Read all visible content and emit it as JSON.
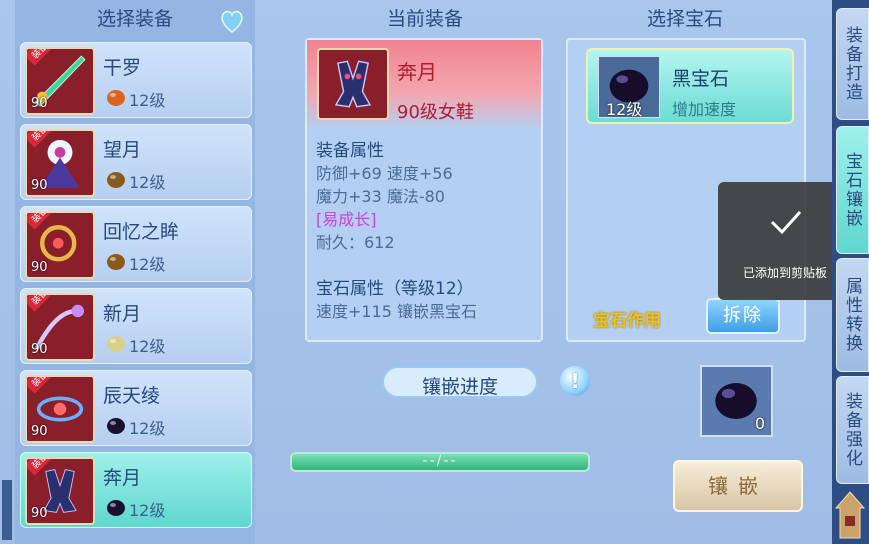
{
  "headers": {
    "left": "选择装备",
    "middle": "当前装备",
    "right": "选择宝石"
  },
  "equipment_list": [
    {
      "name": "干罗",
      "level": "90",
      "tag": "装备中",
      "gem_level": "12级",
      "gem_color": "#d9651f"
    },
    {
      "name": "望月",
      "level": "90",
      "tag": "装备中",
      "gem_level": "12级",
      "gem_color": "#8a5a1c"
    },
    {
      "name": "回忆之眸",
      "level": "90",
      "tag": "装备中",
      "gem_level": "12级",
      "gem_color": "#8a5a1c"
    },
    {
      "name": "新月",
      "level": "90",
      "tag": "装备中",
      "gem_level": "12级",
      "gem_color": "#d8d08a"
    },
    {
      "name": "辰天绫",
      "level": "90",
      "tag": "装备中",
      "gem_level": "12级",
      "gem_color": "#1a1030"
    },
    {
      "name": "奔月",
      "level": "90",
      "tag": "装备中",
      "gem_level": "12级",
      "gem_color": "#1a1030"
    }
  ],
  "current": {
    "name": "奔月",
    "type": "90级女鞋",
    "attr_title": "装备属性",
    "attr_line1": "防御+69 速度+56",
    "attr_line2": "魔力+33 魔法-80",
    "attr_growth": "[易成长]",
    "attr_durability": "耐久：612",
    "gem_attr_title": "宝石属性（等级12）",
    "gem_attr_line": "速度+115 镶嵌黑宝石"
  },
  "gem": {
    "name": "黑宝石",
    "level": "12级",
    "desc": "增加速度",
    "effect_label": "宝石作用",
    "remove_label": "拆除",
    "slot_count": "0"
  },
  "progress": {
    "label": "镶嵌进度",
    "text": "--/--",
    "info": "!"
  },
  "inlay_button": "镶嵌",
  "toast": {
    "text": "已添加到剪贴板"
  },
  "tabs": [
    {
      "label": "装备打造",
      "active": false
    },
    {
      "label": "宝石镶嵌",
      "active": true
    },
    {
      "label": "属性转换",
      "active": false
    },
    {
      "label": "装备强化",
      "active": false
    }
  ]
}
